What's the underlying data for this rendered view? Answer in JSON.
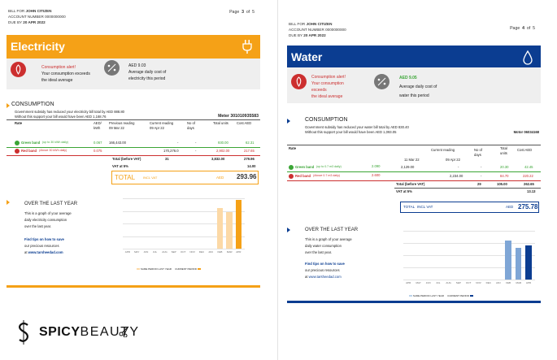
{
  "colors": {
    "electric": "#f5a117",
    "water": "#0b3d91",
    "red": "#cc2f2f",
    "green": "#3aa535",
    "grey_circle": "#777777",
    "total_box_electric": "#f5a117"
  },
  "p3": {
    "bill_for_prefix": "BILL FOR ",
    "customer": "JOHN CITIZEN",
    "account_prefix": "ACCOUNT NUMBER ",
    "account": "0000000000",
    "due_prefix": "DUE BY ",
    "due": "20 APR 2022",
    "page": {
      "label": "Page",
      "current": "3",
      "of": "of",
      "total": "5"
    },
    "title": "Electricity",
    "alert": {
      "line1": "Consumption alert!",
      "line2": "Your consumption exceeds",
      "line3": "the ideal average",
      "cost": "AED 9.03",
      "cost_l2": "Average daily cost of",
      "cost_l3": "electricity this period"
    },
    "consumption": {
      "heading": "CONSUMPTION",
      "subsidy_l1": "Government subsidy has reduced your electricity bill total by AED 888.80",
      "subsidy_l2": "Without this support your bill would have been AED 1,168.76",
      "meter": "Meter 301010935583",
      "headers": {
        "rate": "Rate",
        "aed": "AED/",
        "kwh": "kWh",
        "prev": "Previous reading",
        "prev_date": "09 Mar 22",
        "cur": "Current reading",
        "cur_date": "09 Apr 22",
        "days": "No of",
        "days2": "days",
        "units": "Total units",
        "cost": "Cost AED"
      },
      "green": {
        "name": "Green band",
        "note": "(up to 30 kWh daily)",
        "rate": "0.067",
        "prev": "166,443.00",
        "cur": "-",
        "days": "-",
        "units": "930.00",
        "cost": "62.31"
      },
      "red": {
        "name": "Red band",
        "note": "(Above 30 kWh daily)",
        "rate": "0.075",
        "prev": "",
        "cur": "170,276.0",
        "days": "-",
        "units": "2,902.00",
        "cost": "217.65"
      },
      "total_label": "Total (before VAT)",
      "total_days": "31",
      "total_units": "3,832.00",
      "total_cost": "279.96",
      "vat_label": "VAT at 5%",
      "vat": "14.00",
      "grand_label": "TOTAL",
      "grand_note": "INCL VAT",
      "grand_cur": "AED",
      "grand": "293.96"
    },
    "year": {
      "heading": "OVER THE LAST YEAR",
      "l1": "This is a graph of your average",
      "l2": "daily electricity consumption",
      "l3": "over the last year.",
      "tips": "Find tips on how to save",
      "tips2": "our precious resources",
      "tips3_prefix": "at ",
      "site": "www.tarsheedad.com",
      "legend1": "SAME PERIOD LAST YEAR",
      "legend2": "CURRENT PERIOD"
    }
  },
  "p4": {
    "bill_for_prefix": "BILL FOR ",
    "customer": "JOHN CITIZEN",
    "account_prefix": "ACCOUNT NUMBER ",
    "account": "0000000000",
    "due_prefix": "DUE BY ",
    "due": "20 APR 2022",
    "page": {
      "label": "Page",
      "current": "4",
      "of": "of",
      "total": "5"
    },
    "title": "Water",
    "alert": {
      "line1": "Consumption alert!",
      "line2": "Your consumption",
      "line3": "exceeds",
      "line4": "the ideal average",
      "cost": "AED 9.05",
      "cost_l2": "Average daily cost of",
      "cost_l3": "water this period"
    },
    "consumption": {
      "heading": "CONSUMPTION",
      "subsidy_l1": "Government subsidy has reduced your water bill total by AED 830.40",
      "subsidy_l2": "Without this support your bill would have been AED 1,093.05",
      "meter": "Motor 06034168",
      "headers": {
        "rate": "Rate",
        "cur": "Current reading",
        "days": "No of",
        "days2": "days",
        "units": "Total",
        "units2": "units",
        "cost": "Cost AED",
        "prev_date": "11 Mar 22",
        "cur_date": "09 Apr 22"
      },
      "green": {
        "name": "Green band",
        "note": "(up to 0.7 m3 daily)",
        "rate": "2.090",
        "prev": "2,129.00",
        "cur": "-",
        "days": "-",
        "units": "20.30",
        "cost": "42.45"
      },
      "red": {
        "name": "Red band",
        "note": "(Above 0.7 m3 daily)",
        "rate": "2.600",
        "prev": "",
        "cur": "2,234.00",
        "days": "-",
        "units": "84.70",
        "cost": "220.22"
      },
      "total_label": "Total (before VAT)",
      "total_days": "29",
      "total_units": "105.00",
      "total_cost": "262.65",
      "vat_label": "VAT at 5%",
      "vat": "13.13",
      "grand_label": "TOTAL",
      "grand_note": "INCL VAT",
      "grand_cur": "AED",
      "grand": "275.78"
    },
    "year": {
      "heading": "OVER THE LAST YEAR",
      "l1": "This is a graph of your average",
      "l2": "daily water consumption",
      "l3": "over the last year.",
      "tips": "Find tips on how to save",
      "tips2": "our precious resources",
      "tips3_prefix": "at ",
      "site": "www.tarsheedad.com",
      "legend1": "SAME PERIOD LAST YEAR",
      "legend2": "CURRENT PERIOD"
    }
  },
  "chart_data": [
    {
      "type": "bar",
      "categories": [
        "APR",
        "MAY",
        "JUN",
        "JUL",
        "AUG",
        "SEP",
        "OCT",
        "NOV",
        "DEC",
        "JAN",
        "FEB",
        "MAR",
        "APR"
      ],
      "series": [
        {
          "name": "SAME PERIOD LAST YEAR",
          "values": [
            0,
            0,
            0,
            0,
            0,
            0,
            0,
            0,
            0,
            0,
            0,
            0,
            0
          ]
        },
        {
          "name": "CURRENT PERIOD",
          "values": [
            0,
            0,
            0,
            0,
            0,
            0,
            0,
            0,
            0,
            0,
            120,
            110,
            145
          ]
        }
      ],
      "ylim": [
        0,
        150
      ]
    },
    {
      "type": "bar",
      "categories": [
        "APR",
        "MAY",
        "JUN",
        "JUL",
        "AUG",
        "SEP",
        "OCT",
        "NOV",
        "DEC",
        "JAN",
        "FEB",
        "MAR",
        "APR"
      ],
      "series": [
        {
          "name": "SAME PERIOD LAST YEAR",
          "values": [
            0,
            0,
            0,
            0,
            0,
            0,
            0,
            0,
            0,
            0,
            0,
            0,
            0
          ]
        },
        {
          "name": "CURRENT PERIOD",
          "values": [
            0,
            0,
            0,
            0,
            0,
            0,
            0,
            0,
            0,
            0,
            1.6,
            1.3,
            1.4
          ]
        }
      ],
      "ylim": [
        0,
        2
      ]
    }
  ],
  "brand": {
    "name": "SPICYBEAUTY",
    "part1": "SPICY",
    "part2": "BEAUTY"
  }
}
